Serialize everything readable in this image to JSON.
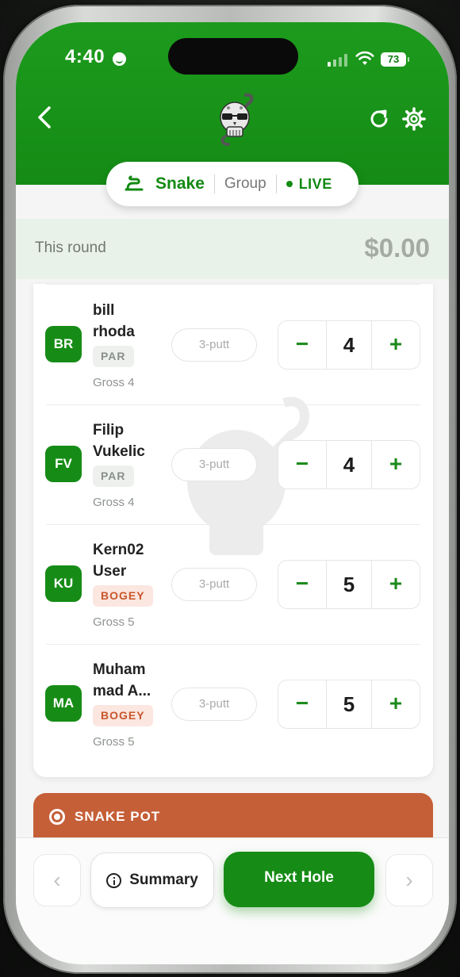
{
  "status_bar": {
    "time": "4:40",
    "battery": "73"
  },
  "header": {
    "logo": "skull-snake-logo"
  },
  "mode_pill": {
    "game": "Snake",
    "scope": "Group",
    "live": "LIVE"
  },
  "round": {
    "label": "This round",
    "amount": "$0.00"
  },
  "players": [
    {
      "initials": "BR",
      "name": "bill\nrhoda",
      "result": "PAR",
      "gross": "Gross 4",
      "putt_label": "3-putt",
      "score": "4"
    },
    {
      "initials": "FV",
      "name": "Filip\nVukelic",
      "result": "PAR",
      "gross": "Gross 4",
      "putt_label": "3-putt",
      "score": "4"
    },
    {
      "initials": "KU",
      "name": "Kern02\nUser",
      "result": "BOGEY",
      "gross": "Gross 5",
      "putt_label": "3-putt",
      "score": "5"
    },
    {
      "initials": "MA",
      "name": "Muham\nmad A...",
      "result": "BOGEY",
      "gross": "Gross 5",
      "putt_label": "3-putt",
      "score": "5"
    }
  ],
  "stepper": {
    "minus": "−",
    "plus": "+"
  },
  "pot": {
    "title": "SNAKE POT"
  },
  "footer": {
    "prev": "‹",
    "next": "›",
    "summary": "Summary",
    "next_hole": "Next Hole"
  },
  "colors": {
    "brand_green": "#158b15",
    "bogey": "#c9562a",
    "pot": "#c55f38"
  }
}
